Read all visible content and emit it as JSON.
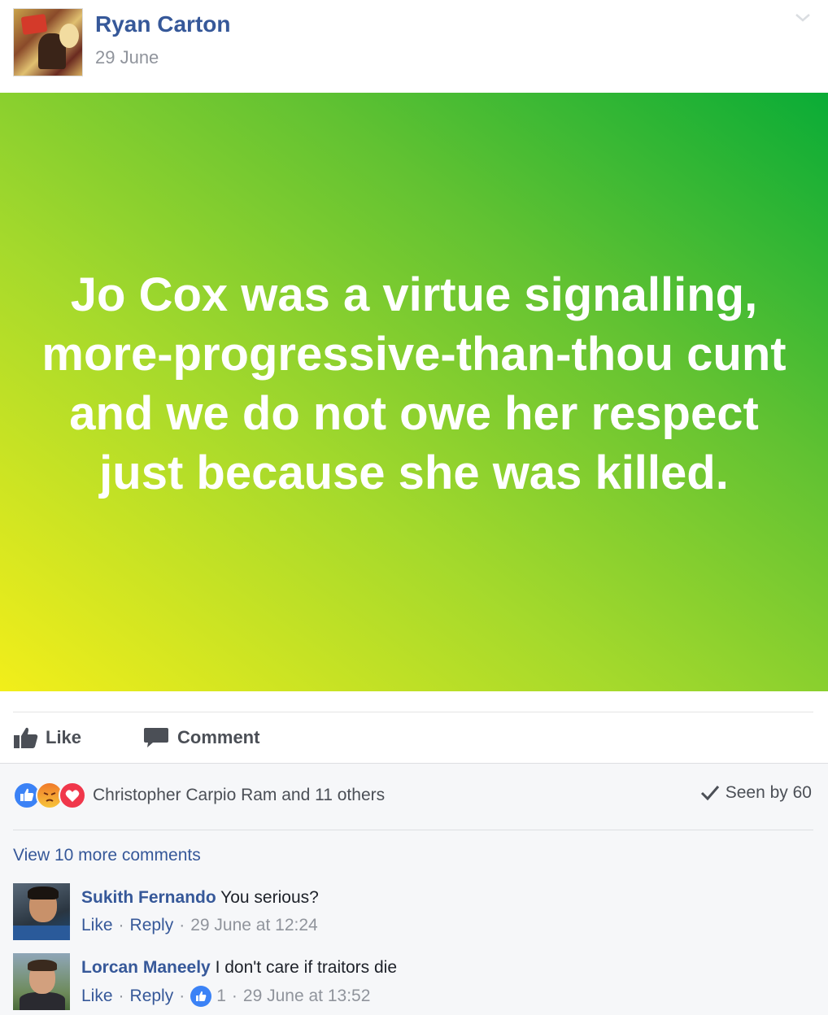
{
  "post": {
    "author": "Ryan Carton",
    "date": "29 June",
    "status_text": "Jo Cox was a virtue signalling, more-progressive-than-thou cunt and we do not owe her respect just because she was killed.",
    "background_gradient": [
      "#f2ee1a",
      "#a4d92c",
      "#62c232",
      "#0aac36"
    ]
  },
  "actions": {
    "like_label": "Like",
    "comment_label": "Comment"
  },
  "feedback": {
    "reactions": [
      "like",
      "angry",
      "love"
    ],
    "reaction_names": "Christopher Carpio Ram and 11 others",
    "seen_by": "Seen by 60",
    "view_more": "View 10 more comments"
  },
  "comments": [
    {
      "author": "Sukith Fernando",
      "text": "You serious?",
      "like": "Like",
      "reply": "Reply",
      "likes_count": "",
      "time": "29 June at 12:24"
    },
    {
      "author": "Lorcan Maneely",
      "text": "I don't care if traitors die",
      "like": "Like",
      "reply": "Reply",
      "likes_count": "1",
      "time": "29 June at 13:52"
    }
  ],
  "colors": {
    "link": "#365899",
    "meta": "#90949c",
    "text": "#1d2129",
    "feedback_bg": "#f6f7f9",
    "like_blue": "#3b82f6",
    "love_red": "#f0374b"
  }
}
